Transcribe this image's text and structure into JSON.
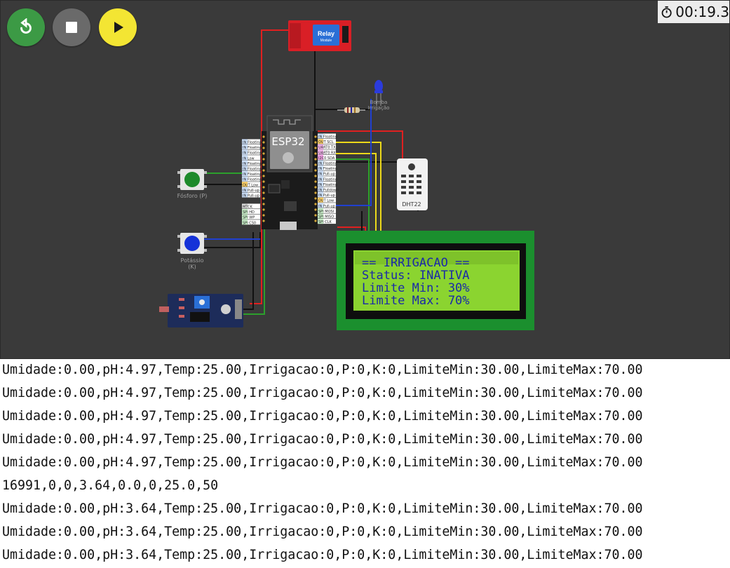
{
  "toolbar": {
    "restart_icon": "restart-icon",
    "stop_icon": "stop-icon",
    "play_icon": "play-icon",
    "restart_color": "#3c9a45",
    "stop_color": "#6a6a6a",
    "play_color": "#f3e533"
  },
  "timer": {
    "icon": "stopwatch-icon",
    "value": "00:19.3"
  },
  "circuit": {
    "relay": {
      "title": "Relay",
      "subtitle": "Module",
      "color": "#d91f26"
    },
    "esp32": {
      "label": "ESP32"
    },
    "led_label": "Bomba\nIrrigação",
    "led_label_line1": "Bomba",
    "led_label_line2": "Irrigação",
    "button_p_label": "Fósforo (P)",
    "button_k_label_line1": "Potássio",
    "button_k_label_line2": "(K)",
    "dht_label": "DHT22",
    "left_pins": [
      "IN Floating",
      "IN Floating",
      "IN Floating",
      "IN Low",
      "IN Floating",
      "IN Floating",
      "IN Floating",
      "IN Floating",
      "OUT Low",
      "IN Pull-up",
      "IN Pull-up"
    ],
    "left_pins_bottom": [
      "MTCK",
      "SPI HD",
      "SPI WP",
      "SPI CS0"
    ],
    "right_pins": [
      "IN Floating",
      "OUT SCL",
      "UART0 TX",
      "UART0 RX",
      "I2C0 SDA",
      "IN Floating",
      "IN Floating",
      "IN Pull-up",
      "IN Floating",
      "IN Floating",
      "IN Pulldown",
      "IN Pull-up",
      "OUT Low",
      "IN Pull-up",
      "SPI MOSI",
      "SPI MISO",
      "SPI CLK"
    ],
    "lcd": {
      "lines": [
        "== IRRIGACAO ==",
        "Status: INATIVA",
        "Limite Min: 30%",
        "Limite Max: 70%"
      ]
    }
  },
  "serial_monitor": {
    "lines": [
      "Umidade:0.00,pH:4.97,Temp:25.00,Irrigacao:0,P:0,K:0,LimiteMin:30.00,LimiteMax:70.00",
      "Umidade:0.00,pH:4.97,Temp:25.00,Irrigacao:0,P:0,K:0,LimiteMin:30.00,LimiteMax:70.00",
      "Umidade:0.00,pH:4.97,Temp:25.00,Irrigacao:0,P:0,K:0,LimiteMin:30.00,LimiteMax:70.00",
      "Umidade:0.00,pH:4.97,Temp:25.00,Irrigacao:0,P:0,K:0,LimiteMin:30.00,LimiteMax:70.00",
      "Umidade:0.00,pH:4.97,Temp:25.00,Irrigacao:0,P:0,K:0,LimiteMin:30.00,LimiteMax:70.00",
      "16991,0,0,3.64,0.0,0,25.0,50",
      "Umidade:0.00,pH:3.64,Temp:25.00,Irrigacao:0,P:0,K:0,LimiteMin:30.00,LimiteMax:70.00",
      "Umidade:0.00,pH:3.64,Temp:25.00,Irrigacao:0,P:0,K:0,LimiteMin:30.00,LimiteMax:70.00",
      "Umidade:0.00,pH:3.64,Temp:25.00,Irrigacao:0,P:0,K:0,LimiteMin:30.00,LimiteMax:70.00"
    ]
  }
}
